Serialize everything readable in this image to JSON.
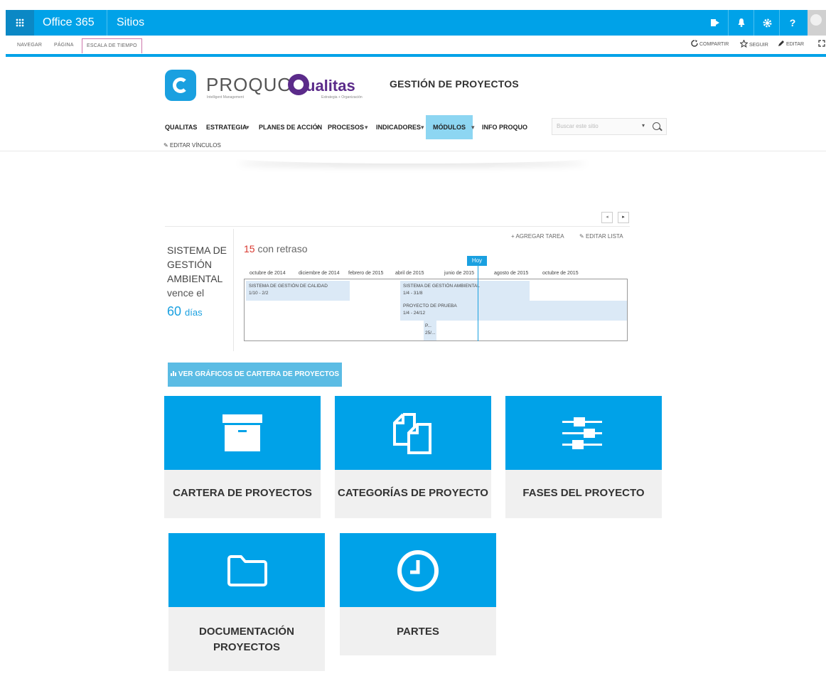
{
  "suite_bar": {
    "app_name": "Office 365",
    "sites_link": "Sitios",
    "icons": [
      "waffle-icon",
      "yammer-icon",
      "bell-icon",
      "gear-icon",
      "help-icon",
      "user-avatar"
    ],
    "help_glyph": "?"
  },
  "ribbon": {
    "tabs": [
      "NAVEGAR",
      "PÁGINA",
      "ESCALA DE TIEMPO"
    ],
    "active_tab": "ESCALA DE TIEMPO",
    "actions": {
      "share": "COMPARTIR",
      "follow": "SEGUIR",
      "edit": "EDITAR"
    }
  },
  "header": {
    "logo_text": "PROQUO",
    "logo_subtext": "Intelligent Management",
    "partner_logo": "ualitas",
    "partner_subtext": "Estrategia + Organización",
    "site_title": "GESTIÓN DE PROYECTOS"
  },
  "nav": {
    "items": [
      "QUALITAS",
      "ESTRATEGIA",
      "PLANES DE ACCIÓN",
      "PROCESOS",
      "INDICADORES",
      "MÓDULOS",
      "INFO PROQUO"
    ],
    "selected": "MÓDULOS",
    "edit_links": "EDITAR VÍNCULOS",
    "search_placeholder": "Buscar este sitio"
  },
  "timeline": {
    "summary_title": "SISTEMA DE GESTIÓN AMBIENTAL",
    "due_prefix": "vence el",
    "due_days": "60",
    "due_unit": "días",
    "late_count": "15",
    "late_text": "con retraso",
    "today_label": "Hoy",
    "add_task": "AGREGAR TAREA",
    "edit_list": "EDITAR LISTA",
    "axis": [
      "octubre de 2014",
      "diciembre de 2014",
      "febrero de 2015",
      "abril de 2015",
      "junio de 2015",
      "agosto de 2015",
      "octubre de 2015"
    ],
    "tasks": [
      {
        "name": "SISTEMA DE GESTIÓN DE CALIDAD",
        "dates": "1/10 - 2/2"
      },
      {
        "name": "SISTEMA DE GESTIÓN AMBIENTAL",
        "dates": "1/4 - 31/8"
      },
      {
        "name": "PROYECTO DE PRUEBA",
        "dates": "1/4 - 24/12"
      },
      {
        "name": "P...",
        "dates": "25/..."
      }
    ]
  },
  "charts_button": "VER GRÁFICOS DE CARTERA DE PROYECTOS",
  "tiles": [
    {
      "label": "CARTERA DE PROYECTOS",
      "icon": "archive-box-icon"
    },
    {
      "label": "CATEGORÍAS DE PROYECTO",
      "icon": "copy-pages-icon"
    },
    {
      "label": "FASES DEL PROYECTO",
      "icon": "sliders-icon"
    },
    {
      "label_line1": "DOCUMENTACIÓN",
      "label_line2": "PROYECTOS",
      "icon": "folder-icon"
    },
    {
      "label": "PARTES",
      "icon": "clock-icon"
    }
  ]
}
